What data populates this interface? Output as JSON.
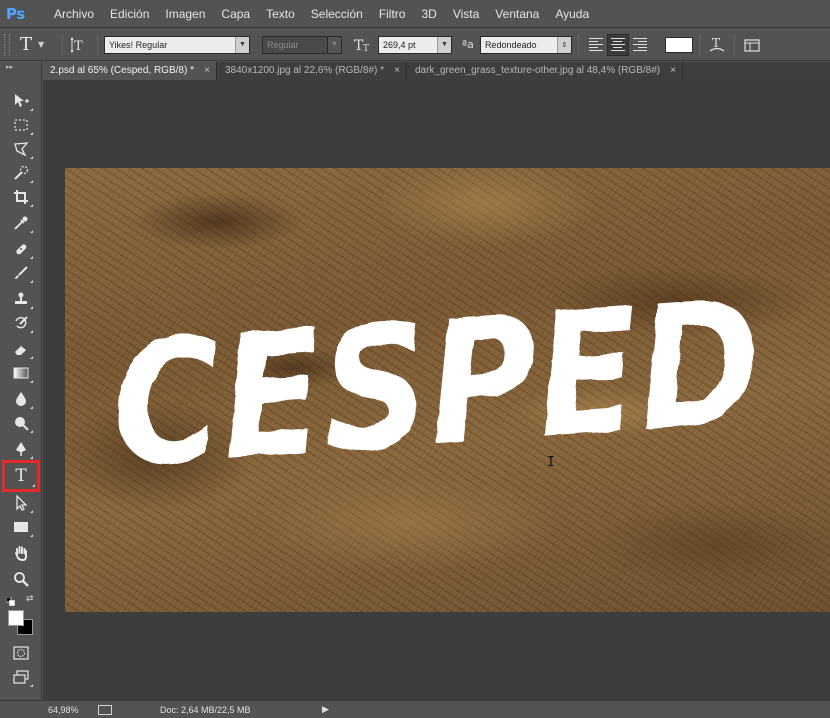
{
  "app": {
    "logo": "Ps",
    "accent": "#4ea6ff"
  },
  "menu": [
    "Archivo",
    "Edición",
    "Imagen",
    "Capa",
    "Texto",
    "Selección",
    "Filtro",
    "3D",
    "Vista",
    "Ventana",
    "Ayuda"
  ],
  "options": {
    "tool_icon": "T",
    "orientation_icon": "text-orientation-icon",
    "font_family": "Yikes! Regular",
    "font_style": "Regular",
    "font_size": "269,4 pt",
    "antialias_label": "ªa",
    "antialias": "Redondeado",
    "text_color": "#ffffff"
  },
  "tabs": [
    {
      "label": "2.psd al 65% (Cesped, RGB/8) *",
      "active": true
    },
    {
      "label": "3840x1200.jpg al 22,6% (RGB/8#) *",
      "active": false
    },
    {
      "label": "dark_green_grass_texture-other.jpg al 48,4% (RGB/8#)",
      "active": false
    }
  ],
  "tab_close": "×",
  "toolbox": {
    "highlight_color": "#e32b2b",
    "selected_tool": "horizontal-type-tool",
    "foreground": "#ffffff",
    "background": "#000000"
  },
  "canvas": {
    "text_layer": "CESPED",
    "text_color": "#ffffff"
  },
  "status": {
    "zoom": "64,98%",
    "doc": "Doc: 2,64 MB/22,5 MB"
  }
}
